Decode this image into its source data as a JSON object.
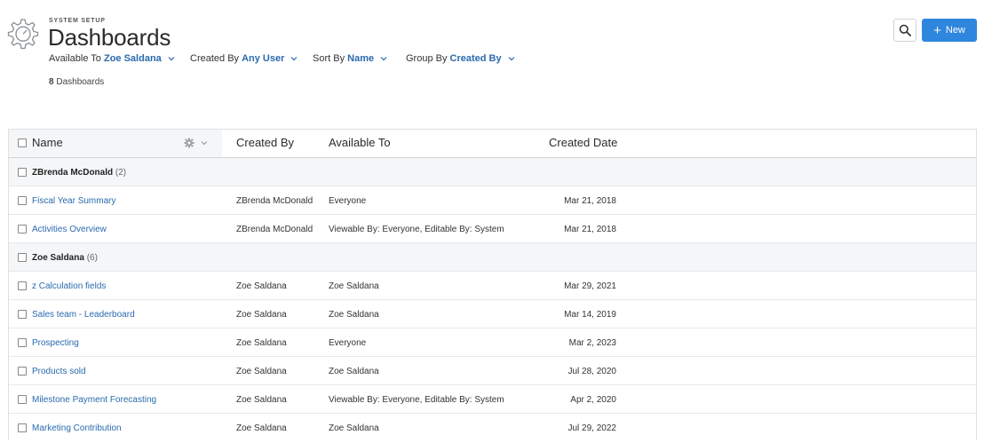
{
  "header": {
    "section_label": "SYSTEM SETUP",
    "title": "Dashboards",
    "count_number": "8",
    "count_label": "Dashboards"
  },
  "filters": [
    {
      "label": "Available To",
      "value": "Zoe Saldana"
    },
    {
      "label": "Created By",
      "value": "Any User"
    },
    {
      "label": "Sort By",
      "value": "Name"
    },
    {
      "label": "Group By",
      "value": "Created By"
    }
  ],
  "actions": {
    "new_label": "New",
    "search_icon": "search-icon",
    "new_color": "#2f86de"
  },
  "table": {
    "columns": [
      "Name",
      "Created By",
      "Available To",
      "Created Date"
    ],
    "groups": [
      {
        "name": "ZBrenda McDonald",
        "count": "(2)",
        "rows": [
          {
            "name": "Fiscal Year Summary",
            "created_by": "ZBrenda McDonald",
            "available_to": "Everyone",
            "created_date": "Mar 21, 2018"
          },
          {
            "name": "Activities Overview",
            "created_by": "ZBrenda McDonald",
            "available_to": "Viewable By: Everyone, Editable By: System",
            "created_date": "Mar 21, 2018"
          }
        ]
      },
      {
        "name": "Zoe Saldana",
        "count": "(6)",
        "rows": [
          {
            "name": "z Calculation fields",
            "created_by": "Zoe Saldana",
            "available_to": "Zoe Saldana",
            "created_date": "Mar 29, 2021"
          },
          {
            "name": "Sales team - Leaderboard",
            "created_by": "Zoe Saldana",
            "available_to": "Zoe Saldana",
            "created_date": "Mar 14, 2019"
          },
          {
            "name": "Prospecting",
            "created_by": "Zoe Saldana",
            "available_to": "Everyone",
            "created_date": "Mar 2, 2023"
          },
          {
            "name": "Products sold",
            "created_by": "Zoe Saldana",
            "available_to": "Zoe Saldana",
            "created_date": "Jul 28, 2020"
          },
          {
            "name": "Milestone Payment Forecasting",
            "created_by": "Zoe Saldana",
            "available_to": "Viewable By: Everyone, Editable By: System",
            "created_date": "Apr 2, 2020"
          },
          {
            "name": "Marketing Contribution",
            "created_by": "Zoe Saldana",
            "available_to": "Zoe Saldana",
            "created_date": "Jul 29, 2022"
          }
        ]
      }
    ]
  }
}
